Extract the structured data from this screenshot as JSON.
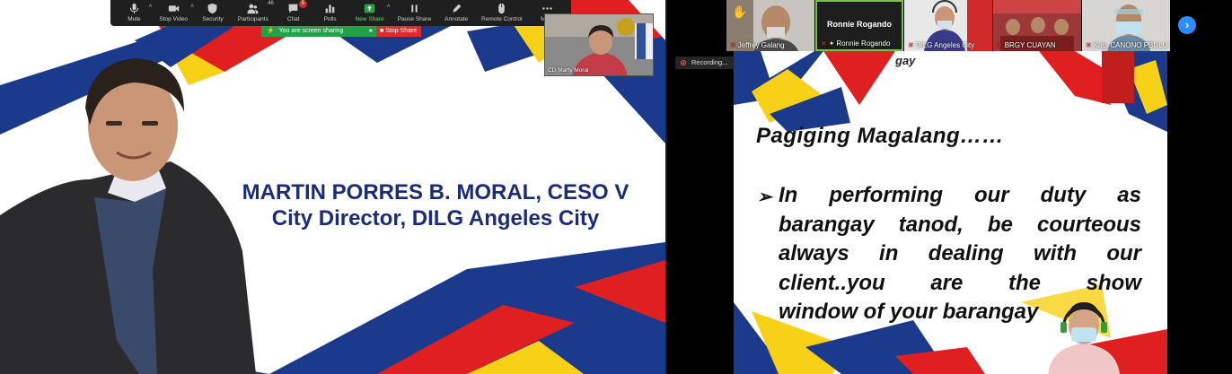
{
  "toolbar": {
    "buttons": [
      {
        "label": "Mute",
        "icon": "microphone-icon"
      },
      {
        "label": "Stop Video",
        "icon": "video-camera-icon"
      },
      {
        "label": "Security",
        "icon": "shield-icon"
      },
      {
        "label": "Participants",
        "icon": "participants-icon",
        "count": "46"
      },
      {
        "label": "Chat",
        "icon": "chat-icon",
        "badge": "5"
      },
      {
        "label": "Polls",
        "icon": "polls-icon"
      },
      {
        "label": "New Share",
        "icon": "share-icon"
      },
      {
        "label": "Pause Share",
        "icon": "pause-icon"
      },
      {
        "label": "Annotate",
        "icon": "pen-icon"
      },
      {
        "label": "Remote Control",
        "icon": "mouse-icon"
      },
      {
        "label": "More",
        "icon": "more-icon"
      }
    ]
  },
  "sharing": {
    "status": "You are screen sharing",
    "stop_label": "Stop Share",
    "accent": "#23a049",
    "stop_color": "#e02b2b"
  },
  "self_view": {
    "name": "CD Marty Moral"
  },
  "left_slide": {
    "name": "MARTIN PORRES B. MORAL, CESO V",
    "title": "City Director, DILG Angeles City",
    "text_color": "#1b2c7a"
  },
  "participants": [
    {
      "name": "Jeffrey Galang",
      "muted": true
    },
    {
      "name": "Ronnie Rogando",
      "muted": true,
      "pinned": true,
      "big_label": "Ronnie Rogando"
    },
    {
      "name": "DILG Angeles City",
      "muted": true
    },
    {
      "name": "BRGY CUAYAN",
      "muted": true
    },
    {
      "name": "Kag. CANONO PBULU",
      "muted": true
    }
  ],
  "recording": {
    "label": "Recording..."
  },
  "right_slide": {
    "partial_title": "gay",
    "heading": "Pagiging Magalang……",
    "bullet": "➢",
    "lines": [
      "In performing our duty as",
      "barangay tanod, be courteous",
      "always in dealing with our",
      "client..you are the show",
      "window of your barangay"
    ]
  },
  "colors": {
    "blue": "#1b3a8c",
    "red": "#e02020",
    "yellow": "#f7d117",
    "zoom_blue": "#2d8cff"
  }
}
